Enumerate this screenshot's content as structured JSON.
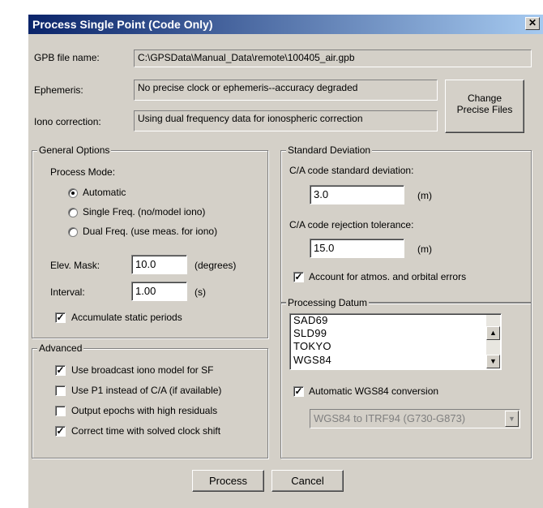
{
  "window": {
    "title": "Process Single Point (Code Only)",
    "close_glyph": "✕"
  },
  "gpb_file": {
    "label": "GPB file name:",
    "value": "C:\\GPSData\\Manual_Data\\remote\\100405_air.gpb"
  },
  "ephemeris": {
    "label": "Ephemeris:",
    "value": "No precise clock or ephemeris--accuracy degraded"
  },
  "iono": {
    "label": "Iono correction:",
    "value": "Using dual frequency data for ionospheric correction"
  },
  "change_precise": {
    "line1": "Change",
    "line2": "Precise Files"
  },
  "general": {
    "legend": "General Options",
    "process_mode_label": "Process Mode:",
    "modes": [
      {
        "label": "Automatic",
        "selected": true
      },
      {
        "label": "Single Freq. (no/model iono)",
        "selected": false
      },
      {
        "label": "Dual Freq. (use meas. for iono)",
        "selected": false
      }
    ],
    "elev_mask_label": "Elev. Mask:",
    "elev_mask_value": "10.0",
    "elev_mask_unit": "(degrees)",
    "interval_label": "Interval:",
    "interval_value": "1.00",
    "interval_unit": "(s)",
    "accumulate_label": "Accumulate static periods",
    "accumulate_checked": true
  },
  "advanced": {
    "legend": "Advanced",
    "options": [
      {
        "label": "Use broadcast iono model for SF",
        "checked": true
      },
      {
        "label": "Use P1 instead of C/A (if available)",
        "checked": false
      },
      {
        "label": "Output epochs with high residuals",
        "checked": false
      },
      {
        "label": "Correct time with solved clock shift",
        "checked": true
      }
    ]
  },
  "stddev": {
    "legend": "Standard Deviation",
    "ca_std_label": "C/A code standard deviation:",
    "ca_std_value": "3.0",
    "ca_std_unit": "(m)",
    "ca_rej_label": "C/A code rejection tolerance:",
    "ca_rej_value": "15.0",
    "ca_rej_unit": "(m)",
    "account_label": "Account for atmos. and orbital errors",
    "account_checked": true
  },
  "datum": {
    "legend": "Processing Datum",
    "items": [
      "SAD69",
      "SLD99",
      "TOKYO",
      "WGS84"
    ],
    "auto_label": "Automatic WGS84 conversion",
    "auto_checked": true,
    "conversion_value": "WGS84 to ITRF94 (G730-G873)"
  },
  "buttons": {
    "process": "Process",
    "cancel": "Cancel"
  }
}
